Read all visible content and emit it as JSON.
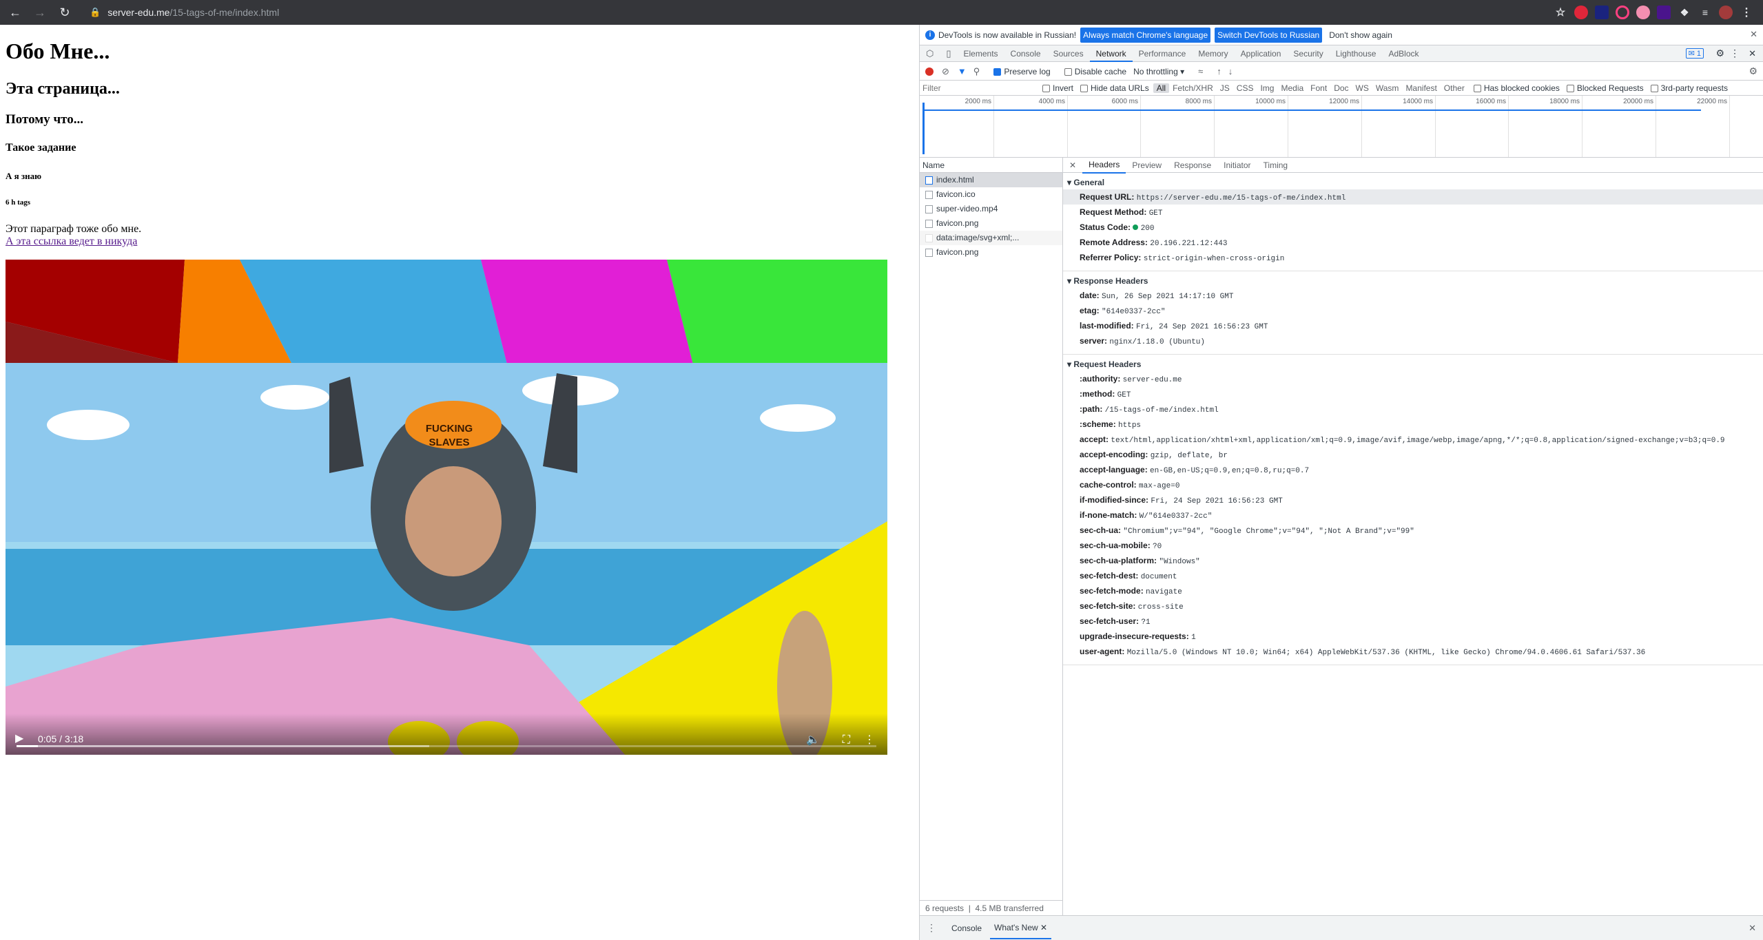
{
  "browser": {
    "url_host": "server-edu.me",
    "url_path": "/15-tags-of-me/index.html"
  },
  "page": {
    "h1": "Обо Мне...",
    "h2": "Эта страница...",
    "h3": "Потому что...",
    "h4": "Такое задание",
    "h5": "А я знаю",
    "h6": "6 h tags",
    "paragraph": "Этот параграф тоже обо мне.",
    "link": "А эта ссылка ведет в никуда"
  },
  "video": {
    "time": "0:05 / 3:18",
    "progress": 0.025,
    "buffered": 0.48,
    "hat_line1": "FUCKING",
    "hat_line2": "SLAVES"
  },
  "devtools": {
    "info_text": "DevTools is now available in Russian!",
    "info_btn1": "Always match Chrome's language",
    "info_btn2": "Switch DevTools to Russian",
    "info_btn3": "Don't show again",
    "tabs": [
      "Elements",
      "Console",
      "Sources",
      "Network",
      "Performance",
      "Memory",
      "Application",
      "Security",
      "Lighthouse",
      "AdBlock"
    ],
    "active_tab": "Network",
    "issues_count": "1",
    "preserve_log": "Preserve log",
    "disable_cache": "Disable cache",
    "throttling": "No throttling",
    "filter_placeholder": "Filter",
    "invert": "Invert",
    "hide_data_urls": "Hide data URLs",
    "filter_types": [
      "All",
      "Fetch/XHR",
      "JS",
      "CSS",
      "Img",
      "Media",
      "Font",
      "Doc",
      "WS",
      "Wasm",
      "Manifest",
      "Other"
    ],
    "has_blocked_cookies": "Has blocked cookies",
    "blocked_requests": "Blocked Requests",
    "third_party": "3rd-party requests",
    "ticks": [
      "2000 ms",
      "4000 ms",
      "6000 ms",
      "8000 ms",
      "10000 ms",
      "12000 ms",
      "14000 ms",
      "16000 ms",
      "18000 ms",
      "20000 ms",
      "22000 ms"
    ],
    "name_header": "Name",
    "requests": [
      "index.html",
      "favicon.ico",
      "super-video.mp4",
      "favicon.png",
      "data:image/svg+xml;...",
      "favicon.png"
    ],
    "status_requests": "6 requests",
    "status_transferred": "4.5 MB transferred",
    "detail_tabs": [
      "Headers",
      "Preview",
      "Response",
      "Initiator",
      "Timing"
    ],
    "general_title": "General",
    "general": [
      {
        "k": "Request URL:",
        "v": "https://server-edu.me/15-tags-of-me/index.html"
      },
      {
        "k": "Request Method:",
        "v": "GET"
      },
      {
        "k": "Status Code:",
        "v": "200"
      },
      {
        "k": "Remote Address:",
        "v": "20.196.221.12:443"
      },
      {
        "k": "Referrer Policy:",
        "v": "strict-origin-when-cross-origin"
      }
    ],
    "response_title": "Response Headers",
    "response": [
      {
        "k": "date:",
        "v": "Sun, 26 Sep 2021 14:17:10 GMT"
      },
      {
        "k": "etag:",
        "v": "\"614e0337-2cc\""
      },
      {
        "k": "last-modified:",
        "v": "Fri, 24 Sep 2021 16:56:23 GMT"
      },
      {
        "k": "server:",
        "v": "nginx/1.18.0 (Ubuntu)"
      }
    ],
    "request_title": "Request Headers",
    "request": [
      {
        "k": ":authority:",
        "v": "server-edu.me"
      },
      {
        "k": ":method:",
        "v": "GET"
      },
      {
        "k": ":path:",
        "v": "/15-tags-of-me/index.html"
      },
      {
        "k": ":scheme:",
        "v": "https"
      },
      {
        "k": "accept:",
        "v": "text/html,application/xhtml+xml,application/xml;q=0.9,image/avif,image/webp,image/apng,*/*;q=0.8,application/signed-exchange;v=b3;q=0.9"
      },
      {
        "k": "accept-encoding:",
        "v": "gzip, deflate, br"
      },
      {
        "k": "accept-language:",
        "v": "en-GB,en-US;q=0.9,en;q=0.8,ru;q=0.7"
      },
      {
        "k": "cache-control:",
        "v": "max-age=0"
      },
      {
        "k": "if-modified-since:",
        "v": "Fri, 24 Sep 2021 16:56:23 GMT"
      },
      {
        "k": "if-none-match:",
        "v": "W/\"614e0337-2cc\""
      },
      {
        "k": "sec-ch-ua:",
        "v": "\"Chromium\";v=\"94\", \"Google Chrome\";v=\"94\", \";Not A Brand\";v=\"99\""
      },
      {
        "k": "sec-ch-ua-mobile:",
        "v": "?0"
      },
      {
        "k": "sec-ch-ua-platform:",
        "v": "\"Windows\""
      },
      {
        "k": "sec-fetch-dest:",
        "v": "document"
      },
      {
        "k": "sec-fetch-mode:",
        "v": "navigate"
      },
      {
        "k": "sec-fetch-site:",
        "v": "cross-site"
      },
      {
        "k": "sec-fetch-user:",
        "v": "?1"
      },
      {
        "k": "upgrade-insecure-requests:",
        "v": "1"
      },
      {
        "k": "user-agent:",
        "v": "Mozilla/5.0 (Windows NT 10.0; Win64; x64) AppleWebKit/537.36 (KHTML, like Gecko) Chrome/94.0.4606.61 Safari/537.36"
      }
    ],
    "drawer_tabs": [
      "Console",
      "What's New"
    ]
  }
}
